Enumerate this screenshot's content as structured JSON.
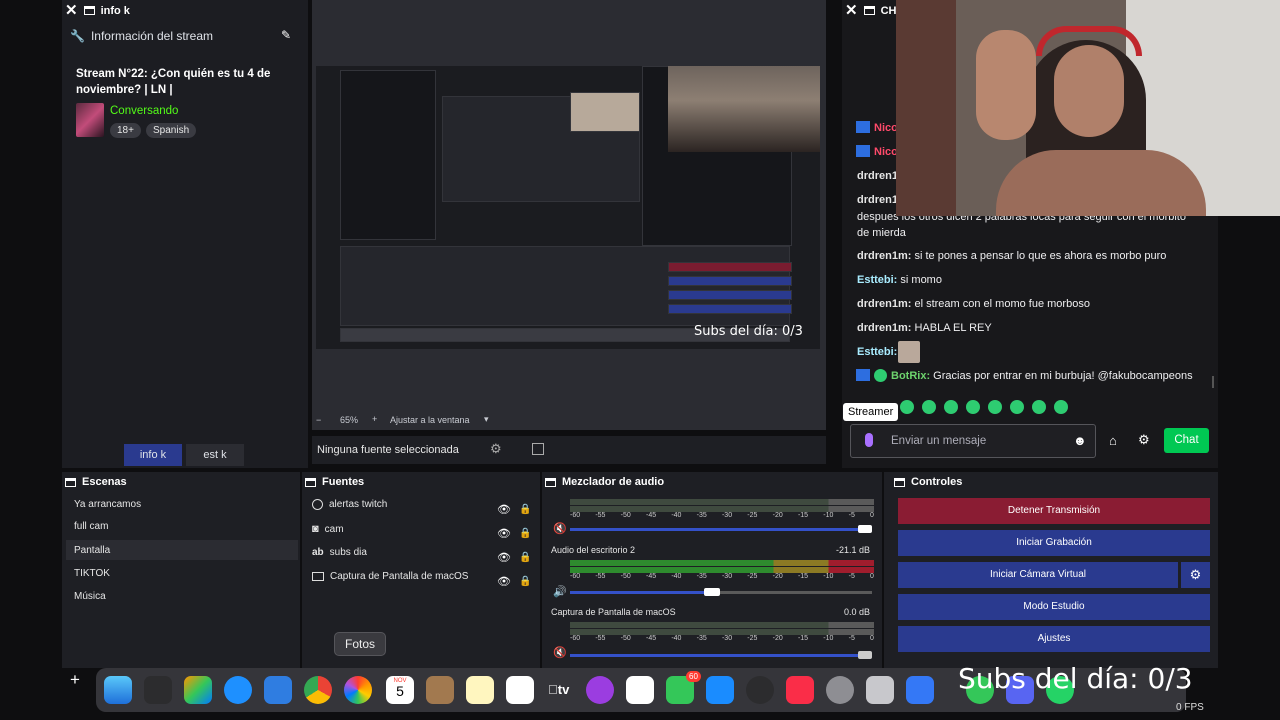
{
  "info_dock": {
    "tab_title": "info k",
    "section_title": "Información del stream",
    "stream_title": "Stream N°22: ¿Con quién es tu 4 de noviembre? | LN |",
    "category": "Conversando",
    "tags": [
      "18+",
      "Spanish"
    ],
    "tabs": [
      "info k",
      "est k"
    ]
  },
  "chat_dock": {
    "tab_title": "CHA",
    "messages": [
      {
        "user": "Nico",
        "text": ""
      },
      {
        "user": "Nico",
        "text": ""
      },
      {
        "user": "drdren1i",
        "text": ""
      },
      {
        "user": "drdren1i",
        "text": ""
      },
      {
        "user": "",
        "text": "despues los otros dicen 2 palabras locas para seguir con el morbito de mierda"
      },
      {
        "user": "drdren1m:",
        "text": "si te pones a pensar lo que es ahora es morbo puro"
      },
      {
        "user": "Esttebi:",
        "text": "si momo"
      },
      {
        "user": "drdren1m:",
        "text": "el stream con el momo fue morboso"
      },
      {
        "user": "drdren1m:",
        "text": "HABLA EL REY"
      },
      {
        "user": "Esttebi:",
        "text": ""
      },
      {
        "user": "BotRix:",
        "text": "Gracias por entrar en mi burbuja! @fakubocampeons"
      }
    ],
    "tooltip": "Streamer",
    "input_placeholder": "Enviar un mensaje",
    "chat_button": "Chat"
  },
  "preview": {
    "overlay_subs": "Subs del día: 0/3",
    "zoom": "65%",
    "zoom_fit": "Ajustar a la ventana",
    "no_source": "Ninguna fuente seleccionada"
  },
  "scenes": {
    "title": "Escenas",
    "items": [
      "Ya arrancamos",
      "full cam",
      "Pantalla",
      "TIKTOK",
      "Música"
    ],
    "selected": "Pantalla"
  },
  "sources": {
    "title": "Fuentes",
    "items": [
      "alertas twitch",
      "cam",
      "subs dia",
      "Captura de Pantalla de macOS"
    ]
  },
  "mixer": {
    "title": "Mezclador de audio",
    "channels": [
      {
        "name": "",
        "db": ""
      },
      {
        "name": "Audio del escritorio 2",
        "db": "-21.1 dB"
      },
      {
        "name": "Captura de Pantalla de macOS",
        "db": "0.0 dB"
      }
    ],
    "ticks": [
      "-60",
      "-55",
      "-50",
      "-45",
      "-40",
      "-35",
      "-30",
      "-25",
      "-20",
      "-15",
      "-10",
      "-5",
      "0"
    ]
  },
  "controls": {
    "title": "Controles",
    "buttons": [
      "Detener Transmisión",
      "Iniciar Grabación",
      "Iniciar Cámara Virtual",
      "Modo Estudio",
      "Ajustes"
    ]
  },
  "dock": {
    "tooltip": "Fotos",
    "calendar_month": "NOV",
    "calendar_day": "5",
    "messages_badge": "60",
    "tv_label": "tv"
  },
  "overlay": {
    "subs_big": "Subs del día: 0/3",
    "fps": "0 FPS"
  },
  "colors": {
    "stop_stream": "#8a1c33",
    "control_blue": "#2a3a8f",
    "chat_green": "#00c853",
    "category_green": "#53fc18"
  }
}
